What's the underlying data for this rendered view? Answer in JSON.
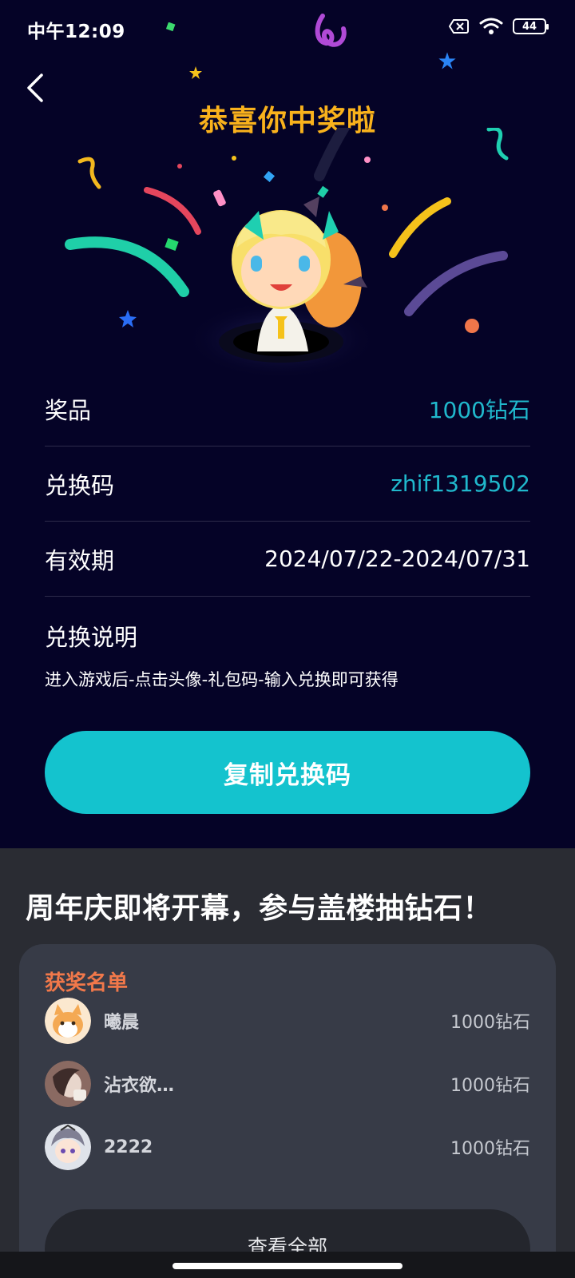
{
  "status_bar": {
    "time": "中午12:09",
    "battery": "44"
  },
  "header": {
    "title": "恭喜你中奖啦"
  },
  "prize_info": {
    "prize_label": "奖品",
    "prize_value": "1000钻石",
    "code_label": "兑换码",
    "code_value": "zhif1319502",
    "validity_label": "有效期",
    "validity_value": "2024/07/22-2024/07/31",
    "instructions_label": "兑换说明",
    "instructions_text": "进入游戏后-点击头像-礼包码-输入兑换即可获得"
  },
  "copy_button": {
    "label": "复制兑换码"
  },
  "promo": {
    "title": "周年庆即将开幕，参与盖楼抽钻石！"
  },
  "winners": {
    "title": "获奖名单",
    "items": [
      {
        "name": "曦晨",
        "prize": "1000钻石"
      },
      {
        "name": "沾衣欲…",
        "prize": "1000钻石"
      },
      {
        "name": "2222",
        "prize": "1000钻石"
      }
    ],
    "view_all_label": "查看全部"
  },
  "colors": {
    "background_top": "#050327",
    "title_gold": "#f9b21c",
    "accent_teal": "#14c3ce",
    "value_teal": "#20b8cc",
    "winners_title": "#f1784a",
    "card_bg": "#373b47"
  }
}
